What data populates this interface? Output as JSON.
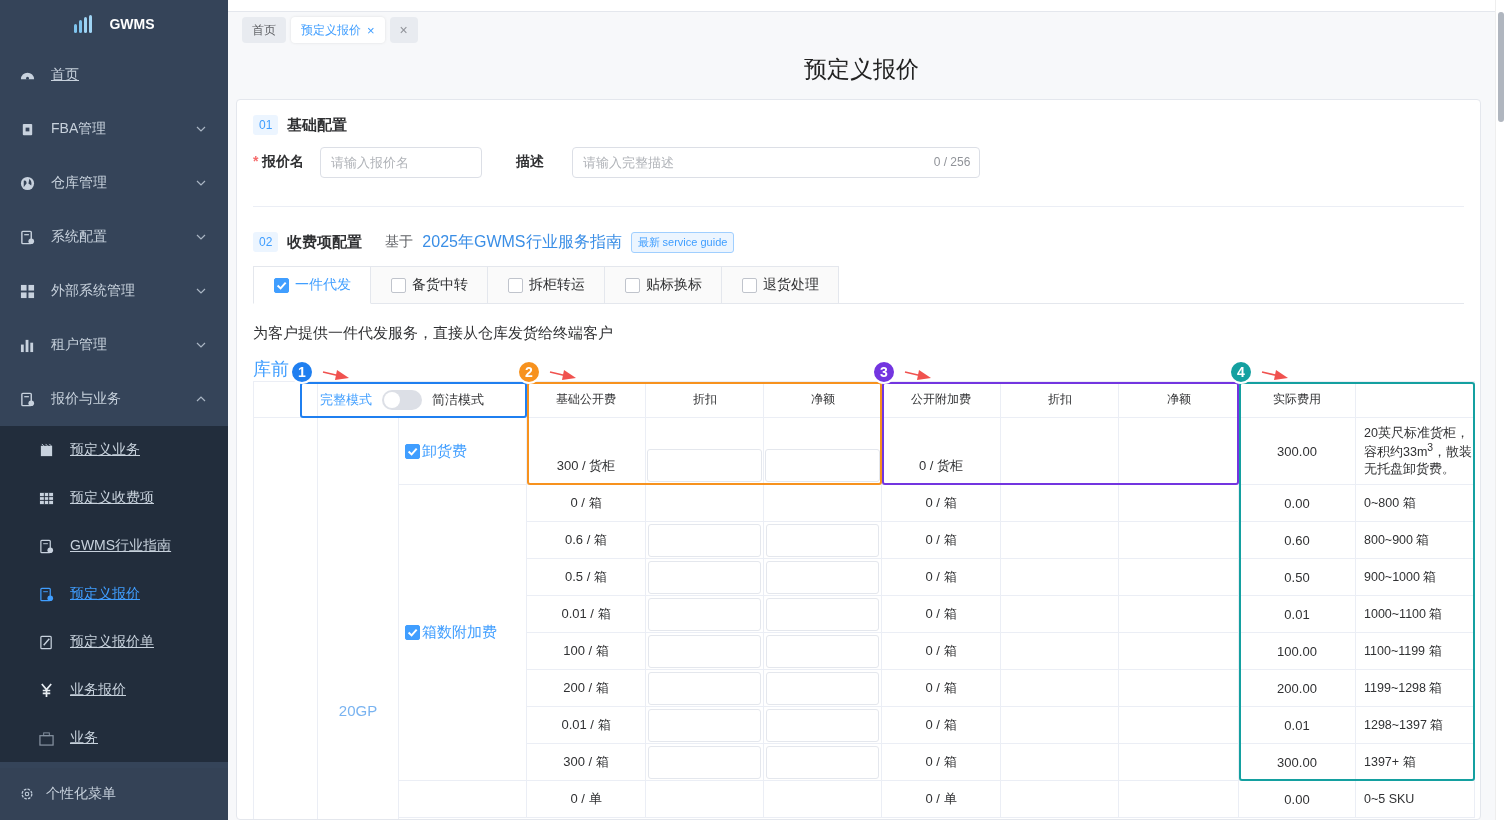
{
  "sidebar": {
    "logo": "GWMS",
    "items": [
      {
        "label": "首页"
      },
      {
        "label": "FBA管理",
        "expanded": false
      },
      {
        "label": "仓库管理",
        "expanded": false
      },
      {
        "label": "系统配置",
        "expanded": false
      },
      {
        "label": "外部系统管理",
        "expanded": false
      },
      {
        "label": "租户管理",
        "expanded": false
      },
      {
        "label": "报价与业务",
        "expanded": true,
        "children": [
          {
            "label": "预定义业务",
            "selected": false
          },
          {
            "label": "预定义收费项",
            "selected": false
          },
          {
            "label": "GWMS行业指南",
            "selected": false
          },
          {
            "label": "预定义报价",
            "selected": true
          },
          {
            "label": "预定义报价单",
            "selected": false
          },
          {
            "label": "业务报价",
            "selected": false
          },
          {
            "label": "业务",
            "selected": false
          }
        ]
      }
    ],
    "footer": "个性化菜单"
  },
  "page_tabs": [
    {
      "label": "首页",
      "selected": false,
      "closable": false
    },
    {
      "label": "预定义报价",
      "selected": true,
      "closable": true
    }
  ],
  "close_all": "×",
  "close_mark": "×",
  "title": "预定义报价",
  "section_basic": {
    "number": "01",
    "title": "基础配置",
    "required_mark": "*",
    "fields": [
      {
        "label": "报价名",
        "required": true,
        "placeholder": "请输入报价名"
      },
      {
        "label": "描述",
        "required": false,
        "placeholder": "请输入完整描述",
        "counter": "0 / 256"
      }
    ]
  },
  "section_fees": {
    "number": "02",
    "title": "收费项配置",
    "based_on": "基于",
    "guide_link": "2025年GWMS行业服务指南",
    "guide_tag": "最新 service guide",
    "service_tabs": [
      {
        "label": "一件代发",
        "checked": true,
        "selected": true
      },
      {
        "label": "备货中转",
        "checked": false,
        "selected": false
      },
      {
        "label": "拆柜转运",
        "checked": false,
        "selected": false
      },
      {
        "label": "贴标换标",
        "checked": false,
        "selected": false
      },
      {
        "label": "退货处理",
        "checked": false,
        "selected": false
      }
    ],
    "description": "为客户提供一件代发服务，直接从仓库发货给终端客户",
    "stage": "库前",
    "mode_switch": {
      "left_label": "完整模式",
      "right_label": "简洁模式",
      "on": false
    },
    "columns": [
      "基础公开费",
      "折扣",
      "净额",
      "公开附加费",
      "折扣",
      "净额",
      "实际费用"
    ],
    "container": "20GP",
    "groups": [
      {
        "name": "卸货费",
        "checked": true,
        "rows": [
          {
            "base": "300 / 货柜",
            "editable": true,
            "surcharge": "0 / 货柜",
            "actual": "300.00",
            "note": "20英尺标准货柜，容积约33m$^{3}$，散装无托盘卸货费。"
          }
        ]
      },
      {
        "name": "箱数附加费",
        "checked": true,
        "rows": [
          {
            "base": "0 / 箱",
            "editable": false,
            "surcharge": "0 / 箱",
            "actual": "0.00",
            "note": "0~800 箱"
          },
          {
            "base": "0.6 / 箱",
            "editable": true,
            "surcharge": "0 / 箱",
            "actual": "0.60",
            "note": "800~900 箱"
          },
          {
            "base": "0.5 / 箱",
            "editable": true,
            "surcharge": "0 / 箱",
            "actual": "0.50",
            "note": "900~1000 箱"
          },
          {
            "base": "0.01 / 箱",
            "editable": true,
            "surcharge": "0 / 箱",
            "actual": "0.01",
            "note": "1000~1100 箱"
          },
          {
            "base": "100 / 箱",
            "editable": true,
            "surcharge": "0 / 箱",
            "actual": "100.00",
            "note": "1100~1199 箱"
          },
          {
            "base": "200 / 箱",
            "editable": true,
            "surcharge": "0 / 箱",
            "actual": "200.00",
            "note": "1199~1298 箱"
          },
          {
            "base": "0.01 / 箱",
            "editable": true,
            "surcharge": "0 / 箱",
            "actual": "0.01",
            "note": "1298~1397 箱"
          },
          {
            "base": "300 / 箱",
            "editable": true,
            "surcharge": "0 / 箱",
            "actual": "300.00",
            "note": "1397+ 箱"
          }
        ]
      },
      {
        "rows": [
          {
            "base": "0 / 单",
            "editable": false,
            "surcharge": "0 / 单",
            "actual": "0.00",
            "note": "0~5 SKU"
          }
        ]
      }
    ],
    "annotations": [
      {
        "number": "1",
        "color": "#1f7ff0"
      },
      {
        "number": "2",
        "color": "#f7921e"
      },
      {
        "number": "3",
        "color": "#7335e0"
      },
      {
        "number": "4",
        "color": "#14a0a0"
      }
    ]
  }
}
